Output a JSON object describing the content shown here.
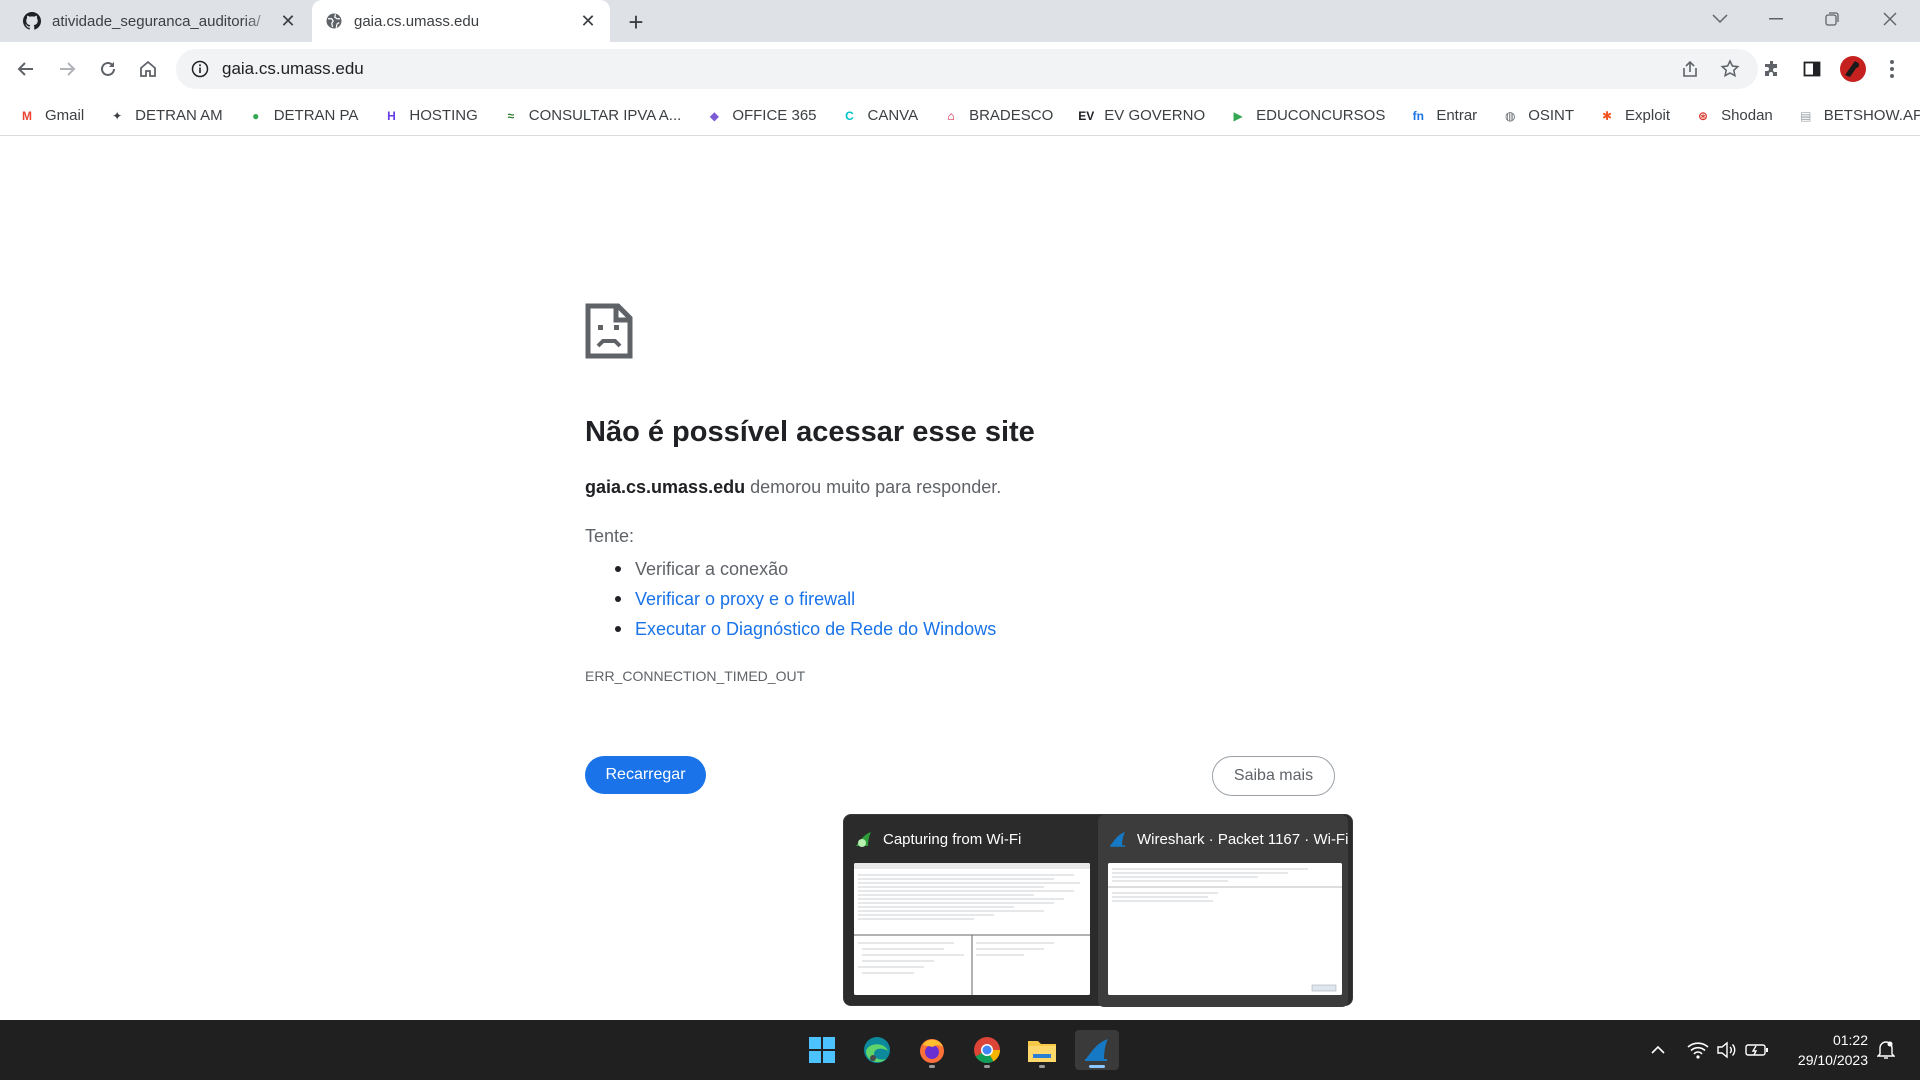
{
  "browser": {
    "tabs": [
      {
        "title": "atividade_seguranca_auditoria/",
        "active": false,
        "icon": "github-icon"
      },
      {
        "title": "gaia.cs.umass.edu",
        "active": true,
        "icon": "globe-icon"
      }
    ],
    "url": "gaia.cs.umass.edu"
  },
  "bookmarks": [
    {
      "label": "Gmail",
      "icon": "gmail-icon",
      "color": "#ea4335"
    },
    {
      "label": "DETRAN AM",
      "icon": "detran-am-icon",
      "color": "#3c4043"
    },
    {
      "label": "DETRAN PA",
      "icon": "detran-pa-icon",
      "color": "#34a853"
    },
    {
      "label": "HOSTING",
      "icon": "hosting-icon",
      "color": "#673de6"
    },
    {
      "label": "CONSULTAR IPVA A...",
      "icon": "ipva-icon",
      "color": "#2e7d32"
    },
    {
      "label": "OFFICE 365",
      "icon": "office-icon",
      "color": "#7b5cd6"
    },
    {
      "label": "CANVA",
      "icon": "canva-icon",
      "color": "#00c4cc"
    },
    {
      "label": "BRADESCO",
      "icon": "bradesco-icon",
      "color": "#cc092f"
    },
    {
      "label": "EV GOVERNO",
      "icon": "evg-icon",
      "color": "#202124"
    },
    {
      "label": "EDUCONCURSOS",
      "icon": "educoncursos-icon",
      "color": "#34a853"
    },
    {
      "label": "Entrar",
      "icon": "fn-icon",
      "color": "#1a73e8"
    },
    {
      "label": "OSINT",
      "icon": "osint-icon",
      "color": "#5f6368"
    },
    {
      "label": "Exploit",
      "icon": "exploit-icon",
      "color": "#f4511e"
    },
    {
      "label": "Shodan",
      "icon": "shodan-icon",
      "color": "#d93025"
    },
    {
      "label": "BETSHOW.APP",
      "icon": "betshow-icon",
      "color": "#9aa0a6"
    }
  ],
  "error": {
    "heading": "Não é possível acessar esse site",
    "host": "gaia.cs.umass.edu",
    "summary_rest": " demorou muito para responder.",
    "tente": "Tente:",
    "suggestions": [
      {
        "text": "Verificar a conexão",
        "link": false
      },
      {
        "text": "Verificar o proxy e o firewall",
        "link": true
      },
      {
        "text": "Executar o Diagnóstico de Rede do Windows",
        "link": true
      }
    ],
    "code": "ERR_CONNECTION_TIMED_OUT",
    "reload_label": "Recarregar",
    "learn_more_label": "Saiba mais"
  },
  "preview": {
    "windows": [
      {
        "title": "Capturing from Wi-Fi",
        "icon": "wireshark-capture-icon"
      },
      {
        "title": "Wireshark · Packet 1167 · Wi-Fi",
        "icon": "wireshark-icon"
      }
    ]
  },
  "taskbar": {
    "apps": [
      "windows-start-icon",
      "edge-icon",
      "firefox-icon",
      "chrome-icon",
      "file-explorer-icon",
      "wireshark-icon"
    ],
    "time": "01:22",
    "date": "29/10/2023"
  },
  "colors": {
    "accent": "#1a73e8",
    "tabstrip": "#dee1e6",
    "taskbar": "#202020"
  }
}
